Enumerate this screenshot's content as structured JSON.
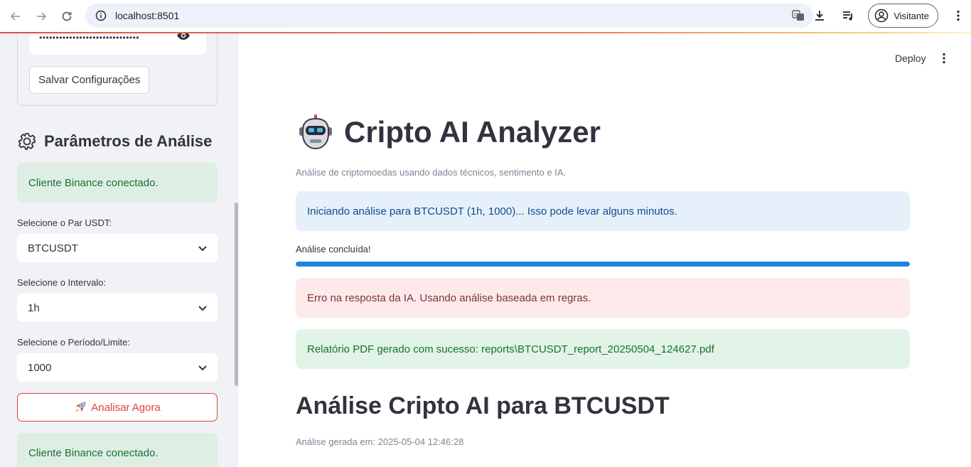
{
  "browser": {
    "url": "localhost:8501",
    "profile_label": "Visitante"
  },
  "sidebar": {
    "password_mask": "••••••••••••••••••••••••••••••",
    "save_label": "Salvar Configurações",
    "section_title": "Parâmetros de Análise",
    "status_top": "Cliente Binance conectado.",
    "pair_label": "Selecione o Par USDT:",
    "pair_value": "BTCUSDT",
    "interval_label": "Selecione o Intervalo:",
    "interval_value": "1h",
    "limit_label": "Selecione o Período/Limite:",
    "limit_value": "1000",
    "run_label": "Analisar Agora",
    "status_bottom": "Cliente Binance conectado."
  },
  "header": {
    "deploy_label": "Deploy"
  },
  "main": {
    "title": "Cripto AI Analyzer",
    "subtitle": "Análise de criptomoedas usando dados técnicos, sentimento e IA.",
    "info_message": "Iniciando análise para BTCUSDT (1h, 1000)... Isso pode levar alguns minutos.",
    "progress_label": "Análise concluída!",
    "progress_value": 1.0,
    "error_message": "Erro na resposta da IA. Usando análise baseada em regras.",
    "success_message": "Relatório PDF gerado com sucesso: reports\\BTCUSDT_report_20250504_124627.pdf",
    "analysis_title": "Análise Cripto AI para BTCUSDT",
    "generated_at": "Análise gerada em: 2025-05-04 12:46:28"
  },
  "colors": {
    "accent_red": "#e0403f",
    "progress_blue": "#1c83e1",
    "success_green": "#177233"
  }
}
